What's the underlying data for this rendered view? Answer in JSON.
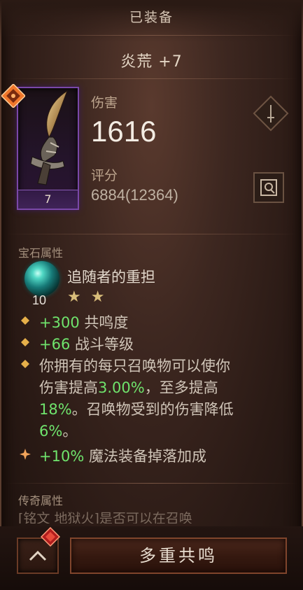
{
  "header": {
    "title": "已装备",
    "item_name": "炎荒 +7"
  },
  "item": {
    "level": "7",
    "damage_label": "伤害",
    "damage_value": "1616",
    "score_label": "评分",
    "score_value": "6884(12364)"
  },
  "gem": {
    "section_title": "宝石属性",
    "name": "追随者的重担",
    "level": "10",
    "stars": "★★",
    "color": "#51d8c5"
  },
  "affixes": [
    {
      "prefix": "+300",
      "suffix": " 共鸣度"
    },
    {
      "prefix": "+66",
      "suffix": " 战斗等级"
    },
    {
      "line1": "你拥有的每只召唤物可以使你",
      "line2_a": "伤害提高",
      "line2_value": "3.00%",
      "line2_b": "，至多提高",
      "line3_value": "18%",
      "line3_b": "。召唤物受到的伤害降低",
      "line4_value": "6%",
      "line4_b": "。"
    },
    {
      "prefix": "+10%",
      "suffix": " 魔法装备掉落加成"
    }
  ],
  "legendary": {
    "section_title": "传奇属性",
    "preview": "[铭文 地狱火]是否可以在召唤"
  },
  "footer": {
    "action_label": "多重共鸣"
  },
  "colors": {
    "highlight_green": "#6fe36c",
    "rune_orange": "#f0772b",
    "portrait_purple": "#7a48a8"
  }
}
